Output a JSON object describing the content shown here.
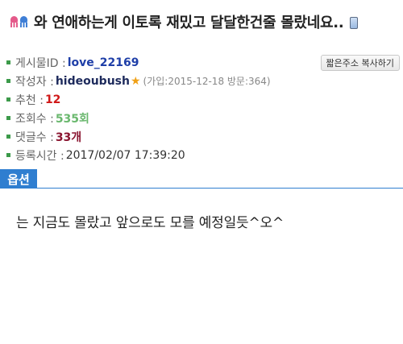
{
  "post": {
    "title": "와 연애하는게 이토록 재밌고 달달한건줄 몰랐네요..",
    "icons": [
      "squid-pink-icon",
      "squid-blue-icon",
      "phone-icon"
    ]
  },
  "info": {
    "post_id_label": "게시물ID :",
    "post_id": "love_22169",
    "author_label": "작성자 :",
    "author": "hideoubush",
    "author_star": "★",
    "author_meta": "(가입:2015-12-18 방문:364)",
    "recommend_label": "추천 :",
    "recommend": "12",
    "views_label": "조회수 :",
    "views": "535회",
    "comments_label": "댓글수 :",
    "comments": "33개",
    "date_label": "등록시간 :",
    "date": "2017/02/07 17:39:20"
  },
  "copy_button": "짧은주소 복사하기",
  "options_tab": "옵션",
  "body": {
    "text": "는 지금도 몰랐고 앞으로도 모를 예정일듯^오^"
  },
  "colors": {
    "accent": "#2f7ed0",
    "bullet": "#3c9a4a",
    "recommend": "#d01818",
    "views": "#6ab86e",
    "comments": "#8a1530"
  }
}
